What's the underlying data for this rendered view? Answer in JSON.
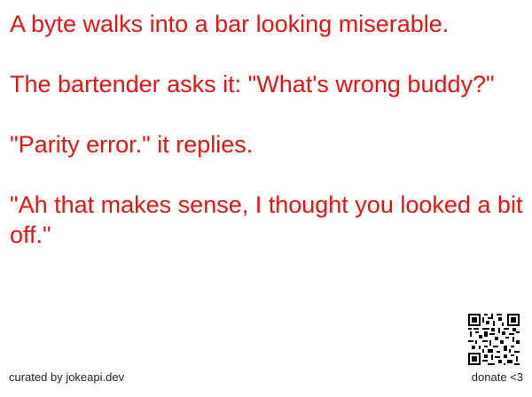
{
  "joke": {
    "line1": "A byte walks into a bar looking miserable.",
    "line2": "The bartender asks it: \"What's wrong buddy?\"",
    "line3": "\"Parity error.\" it replies.",
    "line4": "\"Ah that makes sense, I thought you looked a bit off.\""
  },
  "footer": {
    "curated": "curated by jokeapi.dev",
    "donate": "donate <3"
  },
  "colors": {
    "joke_text": "#e41414",
    "footer_text": "#222222",
    "background": "#ffffff"
  },
  "icons": {
    "qr": "qr-code-icon"
  }
}
